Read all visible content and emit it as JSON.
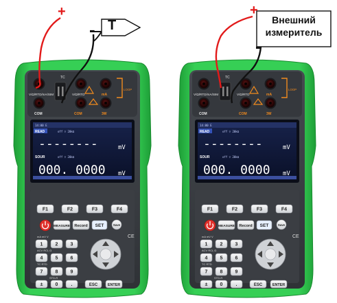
{
  "colors": {
    "case": "#2cc34a",
    "case_dark": "#1c9a35",
    "body": "#3a3d42",
    "body_dark": "#26282c",
    "screen": "#0d1530",
    "lead_red": "#e21a1a",
    "lead_black": "#111111",
    "accent_orange": "#f08a1e"
  },
  "labels": {
    "plus_left": "+",
    "minus_left": "-",
    "tc_label": "T",
    "plus_right": "+",
    "minus_right": "-",
    "external_meter_line1": "Внешний",
    "external_meter_line2": "измеритель"
  },
  "devices": [
    {
      "jack_top_left": "V/Ω/RTD/mA/SIM",
      "jack_top_mid": "TC",
      "jack_top_right": "V/Ω/RTD",
      "jack_far_right": "mA",
      "jack_bottom_left": "COM",
      "jack_bottom_mid": "COM",
      "jack_bottom_right": "3W",
      "loop_label": "LOOP",
      "screen": {
        "status_top": "14:00   E",
        "read_label": "READ",
        "read_sub": "off  ▽ 20kΩ",
        "read_value": "--------",
        "read_unit": "mV",
        "sour_label": "SOUR",
        "sour_sub": "off  ▽ 20kΩ",
        "sour_value": "000. 0000",
        "sour_unit": "mV"
      }
    },
    {
      "jack_top_left": "V/Ω/RTD/mA/SIM",
      "jack_top_mid": "TC",
      "jack_top_right": "V/Ω/RTD",
      "jack_far_right": "mA",
      "jack_bottom_left": "COM",
      "jack_bottom_mid": "COM",
      "jack_bottom_right": "3W",
      "loop_label": "LOOP",
      "screen": {
        "status_top": "14:00   E",
        "read_label": "READ",
        "read_sub": "off  ▽ 20kΩ",
        "read_value": "--------",
        "read_unit": "mV",
        "sour_label": "SOUR",
        "sour_sub": "off  ▽ 20kΩ",
        "sour_value": "000. 0000",
        "sour_unit": "mV"
      }
    }
  ],
  "keys": {
    "f1": "F1",
    "f2": "F2",
    "f3": "F3",
    "f4": "F4",
    "power_icon": "power-icon",
    "measure": "MEASURE",
    "record": "Record",
    "set": "SET",
    "save": "Save",
    "ce": "CE",
    "k1": "1",
    "k2": "2",
    "k3": "3",
    "k4": "4",
    "k5": "5",
    "k6": "6",
    "k7": "7",
    "k8": "8",
    "k9": "9",
    "kpm": "±",
    "k0": "0",
    "kdot": ".",
    "esc": "ESC",
    "enter": "ENTER",
    "row1_small": "mA  mV  V",
    "row2_small": "ACV  RCL  Ω",
    "row3_small": "TC  RTD",
    "row4_small": "STD-R",
    "dpad_up": "up-arrow-icon",
    "dpad_down": "down-arrow-icon",
    "dpad_left": "left-arrow-icon",
    "dpad_right": "right-arrow-icon"
  }
}
